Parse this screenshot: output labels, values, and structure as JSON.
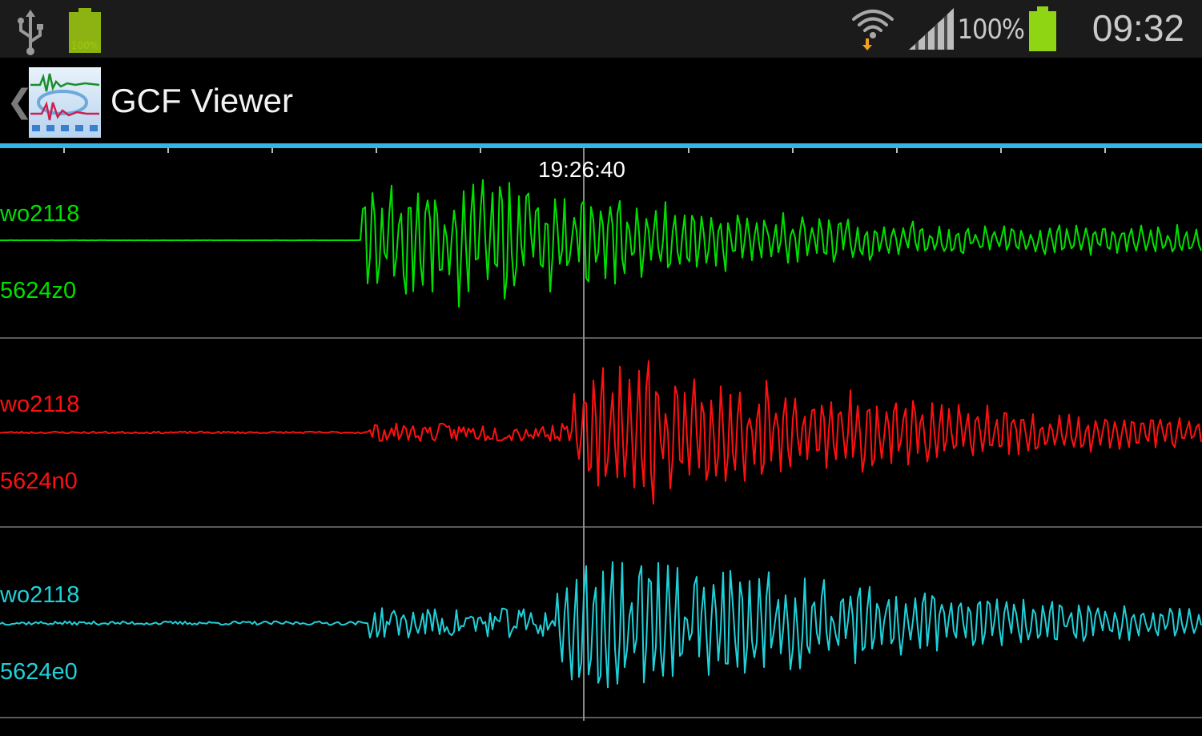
{
  "status_bar": {
    "battery_small_label": "100%",
    "battery_percent": "100%",
    "clock": "09:32",
    "icons": [
      "usb-icon",
      "battery-charging-icon",
      "wifi-icon",
      "signal-icon",
      "battery-icon"
    ]
  },
  "action_bar": {
    "title": "GCF Viewer",
    "back_glyph": "❮",
    "accent_color": "#33b5e5"
  },
  "viewer": {
    "time_marker": "19:26:40",
    "traces": [
      {
        "station": "wo2118",
        "stream": "5624z0",
        "color": "#00e000"
      },
      {
        "station": "wo2118",
        "stream": "5624n0",
        "color": "#ff1010"
      },
      {
        "station": "wo2118",
        "stream": "5624e0",
        "color": "#20d0d8"
      }
    ]
  }
}
